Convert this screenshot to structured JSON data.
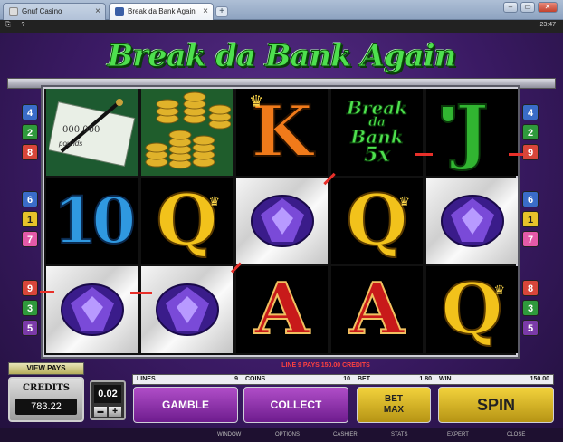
{
  "browser": {
    "tabs": [
      {
        "label": "Gnuf Casino"
      },
      {
        "label": "Break da Bank Again"
      }
    ],
    "new_tab_label": "+",
    "flash_left": "⎘ ?",
    "time": "23:47"
  },
  "game": {
    "logo": "Break da Bank Again",
    "left_lines": [
      "4",
      "2",
      "8",
      "6",
      "1",
      "7",
      "9",
      "3",
      "5"
    ],
    "right_lines": [
      "4",
      "2",
      "9",
      "6",
      "1",
      "7",
      "8",
      "3",
      "5"
    ],
    "win_message": "LINE 9 PAYS 150.00 CREDITS",
    "view_pays_label": "VIEW PAYS",
    "credits_label": "CREDITS",
    "credits_value": "783.22",
    "coin_value": "0.02",
    "coin_down": "▬",
    "coin_up": "✚",
    "info": {
      "lines_label": "LINES",
      "lines_value": "9",
      "coins_label": "COINS",
      "coins_value": "10",
      "bet_label": "BET",
      "bet_value": "1.80",
      "win_label": "WIN",
      "win_value": "150.00"
    },
    "buttons": {
      "gamble": "GAMBLE",
      "collect": "COLLECT",
      "bet_max_1": "BET",
      "bet_max_2": "MAX",
      "spin": "SPIN"
    },
    "reel_symbols": {
      "k": "K",
      "q": "Q",
      "a": "A",
      "j": "J",
      "ten": "10",
      "wild_line1": "Break",
      "wild_line2": "da",
      "wild_line3": "Bank",
      "wild_mult": "5x",
      "cheque_text": "000 000",
      "cheque_words": "pounds"
    },
    "footer": [
      "WINDOW",
      "OPTIONS",
      "CASHIER",
      "STATS",
      "EXPERT",
      "CLOSE"
    ]
  }
}
